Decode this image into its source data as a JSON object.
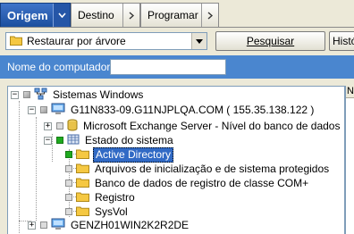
{
  "tabs": [
    {
      "label": "Origem",
      "active": true
    },
    {
      "label": "Destino",
      "active": false
    },
    {
      "label": "Programar",
      "active": false
    }
  ],
  "toolbar": {
    "restore_mode": "Restaurar por árvore",
    "search_label": "Pesquisar",
    "history_label": "Histó"
  },
  "computer_band": {
    "label": "Nome do computador:",
    "value": ""
  },
  "tree": {
    "root": "Sistemas Windows",
    "server1": "G11N833-09.G11NJPLQA.COM ( 155.35.138.122 )",
    "exchange": "Microsoft Exchange Server - Nível do banco de dados",
    "system_state": "Estado do sistema",
    "items": [
      "Active Directory",
      "Arquivos de inicialização e de sistema protegidos",
      "Banco de dados de registro de classe COM+",
      "Registro",
      "SysVol"
    ],
    "server2": "GENZH01WIN2K2R2DE"
  },
  "right_panel": {
    "header": "N"
  },
  "colors": {
    "band": "#4a86cf",
    "active_tab": "#1c4f9e",
    "selection": "#316ac5",
    "check_green": "#1faa1f"
  }
}
